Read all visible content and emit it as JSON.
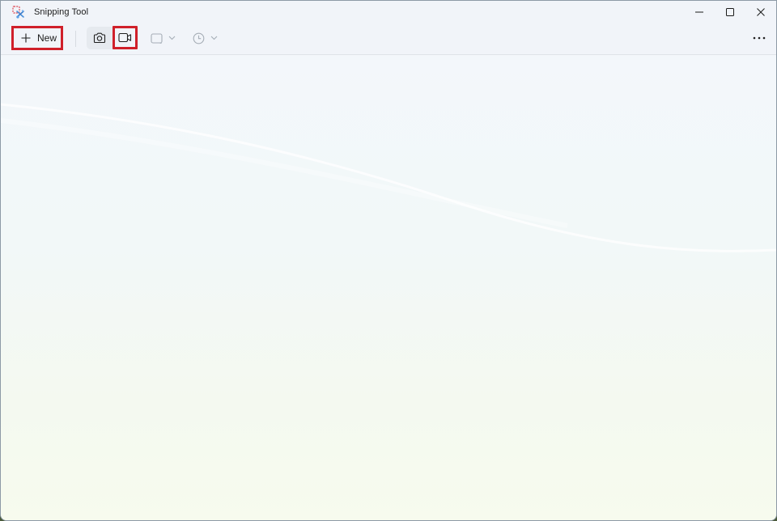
{
  "window": {
    "title": "Snipping Tool",
    "app_icon": "snipping-tool-icon",
    "caption_buttons": [
      {
        "name": "minimize",
        "icon": "minimize-icon"
      },
      {
        "name": "maximize",
        "icon": "maximize-icon"
      },
      {
        "name": "close",
        "icon": "close-icon"
      }
    ]
  },
  "toolbar": {
    "new_label": "New",
    "new_icon": "plus-icon",
    "modes": [
      {
        "name": "snip",
        "icon": "camera-icon",
        "selected": true
      },
      {
        "name": "record",
        "icon": "video-camera-icon",
        "selected": false
      }
    ],
    "snipping_mode_icon": "rectangle-icon",
    "delay_icon": "clock-icon",
    "more_icon": "more-icon",
    "highlight_color": "#d0202a"
  },
  "content": {
    "empty": true
  }
}
